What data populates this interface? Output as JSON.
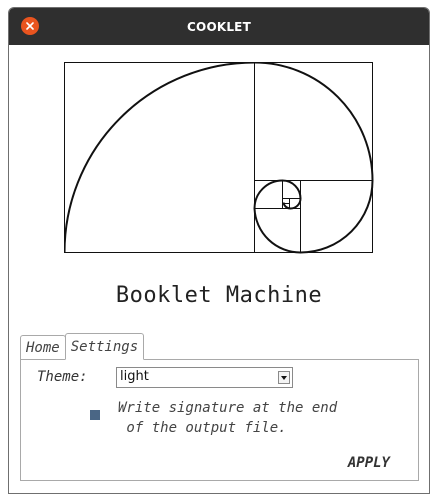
{
  "window": {
    "title": "COOKLET",
    "close_icon": "close-icon"
  },
  "logo": {
    "icon": "golden-spiral-icon"
  },
  "app_heading": "Booklet Machine",
  "tabs": [
    {
      "label": "Home",
      "active": false
    },
    {
      "label": "Settings",
      "active": true
    }
  ],
  "settings": {
    "theme_label": "Theme:",
    "theme_value": "light",
    "signature_checked": true,
    "signature_text": "Write signature at the end\n of the output file.",
    "apply_label": "APPLY"
  },
  "colors": {
    "titlebar": "#2f2f2f",
    "close_button": "#e9541f",
    "checkbox": "#4a6685"
  }
}
